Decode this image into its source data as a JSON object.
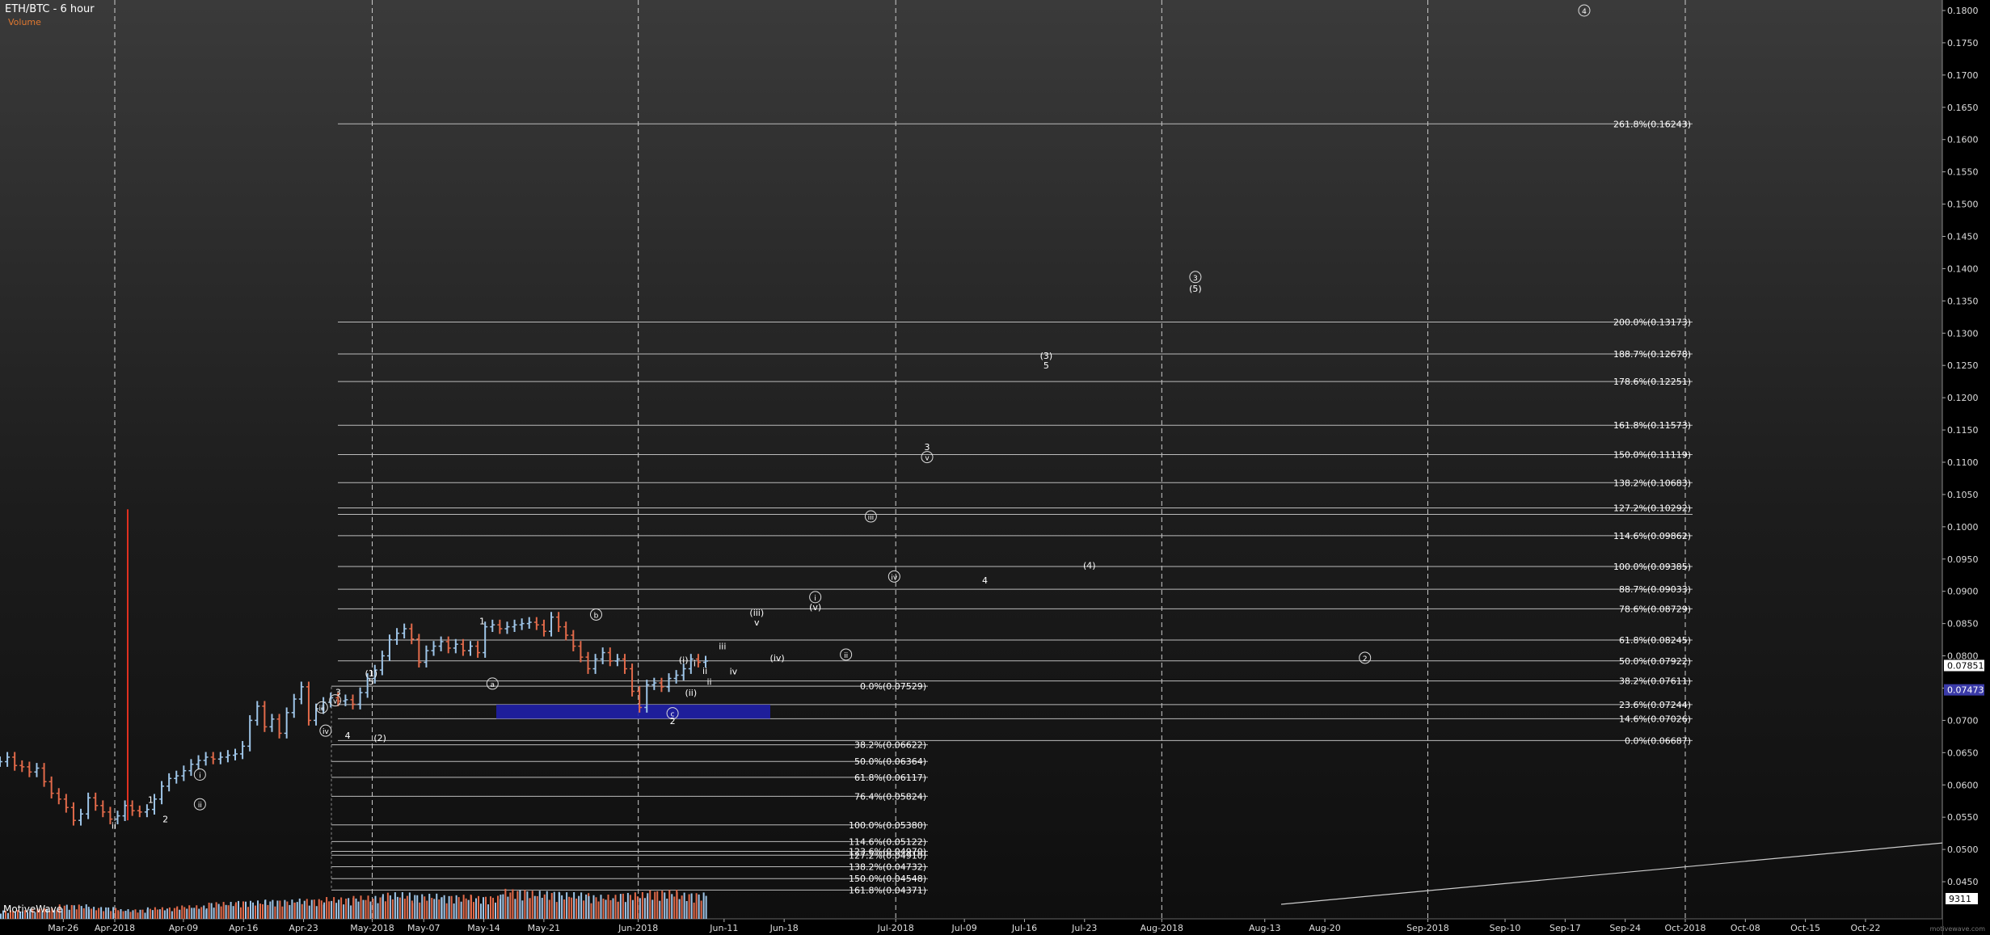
{
  "header": {
    "title": "ETH/BTC - 6 hour",
    "subtitle": "Volume",
    "volume_label": "MotiveWave",
    "watermark": "motivewave.com"
  },
  "chart_data": {
    "type": "candlestick",
    "title": "ETH/BTC - 6 hour",
    "ylim": [
      0.0415,
      0.1805
    ],
    "y_ticks": [
      0.045,
      0.05,
      0.055,
      0.06,
      0.065,
      0.07,
      0.075,
      0.08,
      0.085,
      0.09,
      0.095,
      0.1,
      0.105,
      0.11,
      0.115,
      0.12,
      0.125,
      0.13,
      0.135,
      0.14,
      0.145,
      0.15,
      0.155,
      0.16,
      0.165,
      0.17,
      0.175,
      0.18
    ],
    "x_ticks": [
      "Mar-26",
      "Apr-2018",
      "Apr-09",
      "Apr-16",
      "Apr-23",
      "May-2018",
      "May-07",
      "May-14",
      "May-21",
      "Jun-2018",
      "Jun-11",
      "Jun-18",
      "Jul-2018",
      "Jul-09",
      "Jul-16",
      "Jul-23",
      "Aug-2018",
      "Aug-13",
      "Aug-20",
      "Sep-2018",
      "Sep-10",
      "Sep-17",
      "Sep-24",
      "Oct-2018",
      "Oct-08",
      "Oct-15",
      "Oct-22"
    ],
    "month_lines": [
      "Apr-2018",
      "May-2018",
      "Jun-2018",
      "Jul-2018",
      "Aug-2018",
      "Sep-2018",
      "Oct-2018"
    ],
    "price_labels": [
      {
        "text": "0.07851",
        "value": 0.0785
      },
      {
        "text": "0.07473",
        "value": 0.07473
      }
    ],
    "volume_readout": "9311",
    "fib_right": [
      {
        "text": "261.8%(0.16243)",
        "value": 0.16243
      },
      {
        "text": "200.0%(0.13173)",
        "value": 0.13173
      },
      {
        "text": "188.7%(0.12678)",
        "value": 0.12678
      },
      {
        "text": "178.6%(0.12251)",
        "value": 0.12251
      },
      {
        "text": "161.8%(0.11573)",
        "value": 0.11573
      },
      {
        "text": "150.0%(0.11119)",
        "value": 0.11119
      },
      {
        "text": "138.2%(0.10683)",
        "value": 0.10683
      },
      {
        "text": "127.2%(0.10292)",
        "value": 0.10292
      },
      {
        "text": "114.6%(0.09862)",
        "value": 0.09862
      },
      {
        "text": "100.0%(0.09385)",
        "value": 0.09385
      },
      {
        "text": "88.7%(0.09033)",
        "value": 0.09033
      },
      {
        "text": "78.6%(0.08729)",
        "value": 0.08729
      },
      {
        "text": "61.8%(0.08245)",
        "value": 0.08245
      },
      {
        "text": "50.0%(0.07922)",
        "value": 0.07922
      },
      {
        "text": "38.2%(0.07611)",
        "value": 0.07611
      },
      {
        "text": "23.6%(0.07244)",
        "value": 0.07244
      },
      {
        "text": "14.6%(0.07026)",
        "value": 0.07026
      },
      {
        "text": "0.0%(0.06687)",
        "value": 0.06687
      }
    ],
    "fib_right_extra_line": 0.10192,
    "fib_left": [
      {
        "text": "0.0%(0.07529)",
        "value": 0.07529
      },
      {
        "text": "38.2%(0.06622)",
        "value": 0.06622
      },
      {
        "text": "50.0%(0.06364)",
        "value": 0.06364
      },
      {
        "text": "61.8%(0.06117)",
        "value": 0.06117
      },
      {
        "text": "76.4%(0.05824)",
        "value": 0.05824
      },
      {
        "text": "100.0%(0.05380)",
        "value": 0.0538
      },
      {
        "text": "114.6%(0.05122)",
        "value": 0.05122
      },
      {
        "text": "123.6%(0.04970)",
        "value": 0.0497
      },
      {
        "text": "127.2%(0.04910)",
        "value": 0.0491
      },
      {
        "text": "138.2%(0.04732)",
        "value": 0.04732
      },
      {
        "text": "150.0%(0.04548)",
        "value": 0.04548
      },
      {
        "text": "161.8%(0.04371)",
        "value": 0.04371
      }
    ],
    "target_box": {
      "from": "May-11",
      "to": "Jun-16",
      "low": 0.07026,
      "high": 0.07244,
      "color": "#1f1fa8"
    },
    "trend_line": {
      "from": [
        "Aug-13",
        0.0415
      ],
      "to": [
        "Oct-29",
        0.051
      ]
    },
    "price_series": [
      {
        "day": -8,
        "v": 0.0636
      },
      {
        "day": -7,
        "v": 0.0643
      },
      {
        "day": -6,
        "v": 0.063
      },
      {
        "day": -5,
        "v": 0.0628
      },
      {
        "day": -4,
        "v": 0.062
      },
      {
        "day": -3,
        "v": 0.0626
      },
      {
        "day": -2,
        "v": 0.0605
      },
      {
        "day": -1,
        "v": 0.0587
      },
      {
        "day": 0,
        "v": 0.0578
      },
      {
        "day": 1,
        "v": 0.0565
      },
      {
        "day": 2,
        "v": 0.0545
      },
      {
        "day": 3,
        "v": 0.0555
      },
      {
        "day": 4,
        "v": 0.058
      },
      {
        "day": 5,
        "v": 0.0568
      },
      {
        "day": 6,
        "v": 0.0558
      },
      {
        "day": 7,
        "v": 0.0547
      },
      {
        "day": 8,
        "v": 0.0552
      },
      {
        "day": 9,
        "v": 0.0568
      },
      {
        "day": 10,
        "v": 0.056
      },
      {
        "day": 11,
        "v": 0.0558
      },
      {
        "day": 12,
        "v": 0.0562
      },
      {
        "day": 13,
        "v": 0.0578
      },
      {
        "day": 14,
        "v": 0.0598
      },
      {
        "day": 15,
        "v": 0.061
      },
      {
        "day": 16,
        "v": 0.0614
      },
      {
        "day": 17,
        "v": 0.0622
      },
      {
        "day": 18,
        "v": 0.0632
      },
      {
        "day": 19,
        "v": 0.0638
      },
      {
        "day": 20,
        "v": 0.0643
      },
      {
        "day": 21,
        "v": 0.064
      },
      {
        "day": 22,
        "v": 0.0643
      },
      {
        "day": 23,
        "v": 0.0646
      },
      {
        "day": 24,
        "v": 0.0648
      },
      {
        "day": 25,
        "v": 0.066
      },
      {
        "day": 26,
        "v": 0.07
      },
      {
        "day": 27,
        "v": 0.0722
      },
      {
        "day": 28,
        "v": 0.069
      },
      {
        "day": 29,
        "v": 0.0702
      },
      {
        "day": 30,
        "v": 0.068
      },
      {
        "day": 31,
        "v": 0.0712
      },
      {
        "day": 32,
        "v": 0.0733
      },
      {
        "day": 33,
        "v": 0.0752
      },
      {
        "day": 34,
        "v": 0.07
      },
      {
        "day": 35,
        "v": 0.0718
      },
      {
        "day": 36,
        "v": 0.0728
      },
      {
        "day": 37,
        "v": 0.0735
      },
      {
        "day": 38,
        "v": 0.073
      },
      {
        "day": 39,
        "v": 0.0732
      },
      {
        "day": 40,
        "v": 0.0725
      },
      {
        "day": 41,
        "v": 0.0743
      },
      {
        "day": 42,
        "v": 0.0765
      },
      {
        "day": 43,
        "v": 0.0778
      },
      {
        "day": 44,
        "v": 0.08
      },
      {
        "day": 45,
        "v": 0.0825
      },
      {
        "day": 46,
        "v": 0.0835
      },
      {
        "day": 47,
        "v": 0.0842
      },
      {
        "day": 48,
        "v": 0.0826
      },
      {
        "day": 49,
        "v": 0.079
      },
      {
        "day": 50,
        "v": 0.0808
      },
      {
        "day": 51,
        "v": 0.0815
      },
      {
        "day": 52,
        "v": 0.0822
      },
      {
        "day": 53,
        "v": 0.0812
      },
      {
        "day": 54,
        "v": 0.0818
      },
      {
        "day": 55,
        "v": 0.0808
      },
      {
        "day": 56,
        "v": 0.0815
      },
      {
        "day": 57,
        "v": 0.0805
      },
      {
        "day": 58,
        "v": 0.0845
      },
      {
        "day": 59,
        "v": 0.0848
      },
      {
        "day": 60,
        "v": 0.0842
      },
      {
        "day": 61,
        "v": 0.0845
      },
      {
        "day": 62,
        "v": 0.0848
      },
      {
        "day": 63,
        "v": 0.085
      },
      {
        "day": 64,
        "v": 0.0852
      },
      {
        "day": 65,
        "v": 0.0848
      },
      {
        "day": 66,
        "v": 0.0838
      },
      {
        "day": 67,
        "v": 0.086
      },
      {
        "day": 68,
        "v": 0.0845
      },
      {
        "day": 69,
        "v": 0.0832
      },
      {
        "day": 70,
        "v": 0.0815
      },
      {
        "day": 71,
        "v": 0.0798
      },
      {
        "day": 72,
        "v": 0.078
      },
      {
        "day": 73,
        "v": 0.0795
      },
      {
        "day": 74,
        "v": 0.0805
      },
      {
        "day": 75,
        "v": 0.0792
      },
      {
        "day": 76,
        "v": 0.0795
      },
      {
        "day": 77,
        "v": 0.078
      },
      {
        "day": 78,
        "v": 0.0745
      },
      {
        "day": 79,
        "v": 0.072
      },
      {
        "day": 80,
        "v": 0.0755
      },
      {
        "day": 81,
        "v": 0.0758
      },
      {
        "day": 82,
        "v": 0.0752
      },
      {
        "day": 83,
        "v": 0.0765
      },
      {
        "day": 84,
        "v": 0.077
      },
      {
        "day": 85,
        "v": 0.078
      },
      {
        "day": 86,
        "v": 0.0795
      },
      {
        "day": 87,
        "v": 0.079
      },
      {
        "day": 88,
        "v": 0.0792
      }
    ],
    "spike": {
      "day": 2.5,
      "high": 0.1027,
      "low": 0.0545
    },
    "volume_series": [
      {
        "day": -8,
        "v": 0.18
      },
      {
        "day": -4,
        "v": 0.22
      },
      {
        "day": 0,
        "v": 0.3
      },
      {
        "day": 4,
        "v": 0.25
      },
      {
        "day": 8,
        "v": 0.2
      },
      {
        "day": 12,
        "v": 0.24
      },
      {
        "day": 16,
        "v": 0.28
      },
      {
        "day": 20,
        "v": 0.35
      },
      {
        "day": 24,
        "v": 0.38
      },
      {
        "day": 28,
        "v": 0.4
      },
      {
        "day": 32,
        "v": 0.42
      },
      {
        "day": 36,
        "v": 0.45
      },
      {
        "day": 40,
        "v": 0.48
      },
      {
        "day": 44,
        "v": 0.55
      },
      {
        "day": 48,
        "v": 0.52
      },
      {
        "day": 52,
        "v": 0.5
      },
      {
        "day": 56,
        "v": 0.48
      },
      {
        "day": 60,
        "v": 0.62
      },
      {
        "day": 64,
        "v": 0.58
      },
      {
        "day": 68,
        "v": 0.55
      },
      {
        "day": 72,
        "v": 0.5
      },
      {
        "day": 76,
        "v": 0.55
      },
      {
        "day": 80,
        "v": 0.6
      },
      {
        "day": 84,
        "v": 0.55
      },
      {
        "day": 88,
        "v": 0.5
      }
    ],
    "wave_labels": [
      {
        "text": "ii",
        "day": 7.5,
        "value": 0.0532,
        "circle": false
      },
      {
        "text": "1",
        "day": 12.5,
        "value": 0.0572,
        "circle": false
      },
      {
        "text": "2",
        "day": 14.5,
        "value": 0.0542,
        "circle": false
      },
      {
        "text": "i",
        "day": 19.2,
        "value": 0.0611,
        "circle": true
      },
      {
        "text": "ii",
        "day": 19.2,
        "value": 0.0565,
        "circle": true
      },
      {
        "text": "3",
        "day": 38,
        "value": 0.0739,
        "circle": false
      },
      {
        "text": "iii",
        "day": 35.8,
        "value": 0.0715,
        "circle": true
      },
      {
        "text": "v",
        "day": 37.6,
        "value": 0.0726,
        "circle": true
      },
      {
        "text": "iv",
        "day": 36.3,
        "value": 0.0679,
        "circle": true
      },
      {
        "text": "4",
        "day": 39.3,
        "value": 0.0672,
        "circle": false
      },
      {
        "text": "(1)",
        "day": 42.5,
        "value": 0.0768,
        "circle": false
      },
      {
        "text": "5",
        "day": 42.5,
        "value": 0.0755,
        "circle": false
      },
      {
        "text": "(2)",
        "day": 43.7,
        "value": 0.0668,
        "circle": false
      },
      {
        "text": "1",
        "day": 57.6,
        "value": 0.0849,
        "circle": false
      },
      {
        "text": "a",
        "day": 59,
        "value": 0.0752,
        "circle": true
      },
      {
        "text": "b",
        "day": 73.1,
        "value": 0.0859,
        "circle": true
      },
      {
        "text": "c",
        "day": 83.5,
        "value": 0.0706,
        "circle": true
      },
      {
        "text": "2",
        "day": 83.5,
        "value": 0.0694,
        "circle": false
      },
      {
        "text": "(i)",
        "day": 85,
        "value": 0.0789,
        "circle": false
      },
      {
        "text": "i",
        "day": 86.5,
        "value": 0.0784,
        "circle": false
      },
      {
        "text": "ii",
        "day": 87.9,
        "value": 0.0772,
        "circle": false
      },
      {
        "text": "(ii)",
        "day": 86,
        "value": 0.0738,
        "circle": false
      },
      {
        "text": "iii",
        "day": 90.3,
        "value": 0.081,
        "circle": false
      },
      {
        "text": "iv",
        "day": 91.8,
        "value": 0.0771,
        "circle": false
      },
      {
        "text": "ii",
        "day": 88.5,
        "value": 0.0755,
        "circle": false
      },
      {
        "text": "(iii)",
        "day": 95,
        "value": 0.0862,
        "circle": false
      },
      {
        "text": "v",
        "day": 95,
        "value": 0.0847,
        "circle": false
      },
      {
        "text": "(iv)",
        "day": 97.8,
        "value": 0.0792,
        "circle": false
      },
      {
        "text": "i",
        "day": 103,
        "value": 0.0886,
        "circle": true
      },
      {
        "text": "(v)",
        "day": 103,
        "value": 0.0871,
        "circle": false
      },
      {
        "text": "ii",
        "day": 107.2,
        "value": 0.0797,
        "circle": true
      },
      {
        "text": "iii",
        "day": 110.6,
        "value": 0.1011,
        "circle": true
      },
      {
        "text": "iv",
        "day": 113.8,
        "value": 0.0918,
        "circle": true
      },
      {
        "text": "3",
        "day": 118.3,
        "value": 0.1119,
        "circle": false
      },
      {
        "text": "v",
        "day": 118.3,
        "value": 0.1103,
        "circle": true
      },
      {
        "text": "4",
        "day": 126.2,
        "value": 0.0912,
        "circle": false
      },
      {
        "text": "(3)",
        "day": 134.6,
        "value": 0.126,
        "circle": false
      },
      {
        "text": "5",
        "day": 134.6,
        "value": 0.1245,
        "circle": false
      },
      {
        "text": "(4)",
        "day": 140.5,
        "value": 0.0935,
        "circle": false
      },
      {
        "text": "3",
        "day": 155,
        "value": 0.1382,
        "circle": true
      },
      {
        "text": "(5)",
        "day": 155,
        "value": 0.1364,
        "circle": false
      },
      {
        "text": "2",
        "day": 178.2,
        "value": 0.0792,
        "circle": true
      },
      {
        "text": "4",
        "day": 208.2,
        "value": 0.1795,
        "circle": true
      }
    ]
  }
}
